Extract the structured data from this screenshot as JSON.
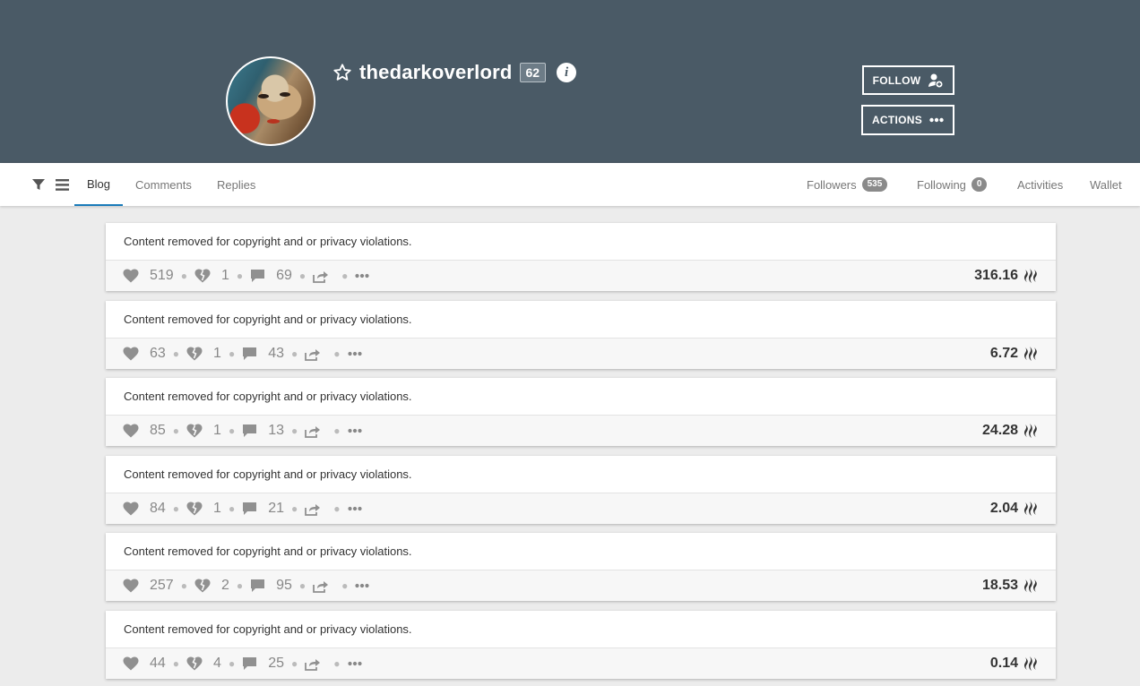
{
  "profile": {
    "username": "thedarkoverlord",
    "reputation": "62",
    "follow_label": "FOLLOW",
    "actions_label": "ACTIONS",
    "colors": {
      "header_bg": "#4a5a66",
      "active_tab": "#1a7bb9"
    }
  },
  "tabs": {
    "blog": "Blog",
    "comments": "Comments",
    "replies": "Replies",
    "followers": "Followers",
    "followers_count": "535",
    "following": "Following",
    "following_count": "0",
    "activities": "Activities",
    "wallet": "Wallet"
  },
  "posts": [
    {
      "text": "Content removed for copyright and or privacy violations.",
      "upvotes": "519",
      "downvotes": "1",
      "comments": "69",
      "payout": "316.16"
    },
    {
      "text": "Content removed for copyright and or privacy violations.",
      "upvotes": "63",
      "downvotes": "1",
      "comments": "43",
      "payout": "6.72"
    },
    {
      "text": "Content removed for copyright and or privacy violations.",
      "upvotes": "85",
      "downvotes": "1",
      "comments": "13",
      "payout": "24.28"
    },
    {
      "text": "Content removed for copyright and or privacy violations.",
      "upvotes": "84",
      "downvotes": "1",
      "comments": "21",
      "payout": "2.04"
    },
    {
      "text": "Content removed for copyright and or privacy violations.",
      "upvotes": "257",
      "downvotes": "2",
      "comments": "95",
      "payout": "18.53"
    },
    {
      "text": "Content removed for copyright and or privacy violations.",
      "upvotes": "44",
      "downvotes": "4",
      "comments": "25",
      "payout": "0.14"
    }
  ]
}
